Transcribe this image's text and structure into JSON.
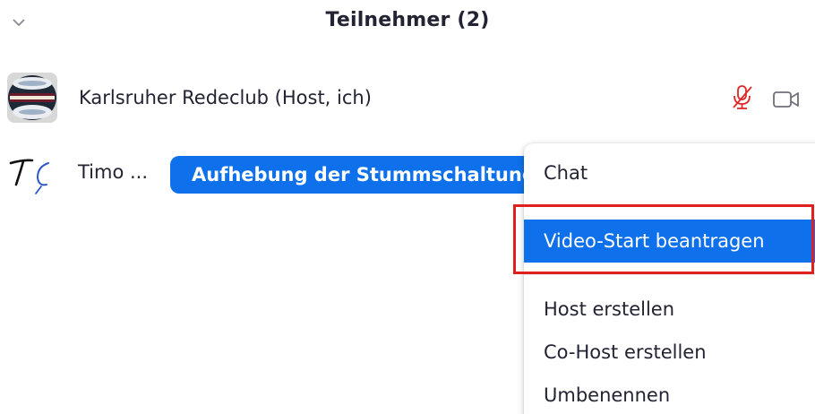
{
  "header": {
    "title": "Teilnehmer (2)",
    "collapse_icon": "chevron-down-icon"
  },
  "participants": [
    {
      "name": "Karlsruher Redeclub (Host, ich)",
      "avatar_icon": "toastmasters-globe-icon",
      "mic_icon": "mic-muted-icon",
      "mic_muted": true,
      "video_icon": "video-camera-icon",
      "mic_color": "#e02828"
    },
    {
      "name": "Timo ...",
      "avatar_icon": "signature-t-icon",
      "action_button_label": "Aufhebung der Stummschaltung"
    }
  ],
  "context_menu": {
    "items": [
      {
        "label": "Chat",
        "highlighted": false
      },
      {
        "label": "Video-Start beantragen",
        "highlighted": true
      },
      {
        "label": "Host erstellen",
        "highlighted": false
      },
      {
        "label": "Co-Host erstellen",
        "highlighted": false
      },
      {
        "label": "Umbenennen",
        "highlighted": false
      }
    ]
  },
  "colors": {
    "accent_blue": "#0e71eb",
    "annotation_red": "#e0201f",
    "text_dark": "#232333"
  }
}
